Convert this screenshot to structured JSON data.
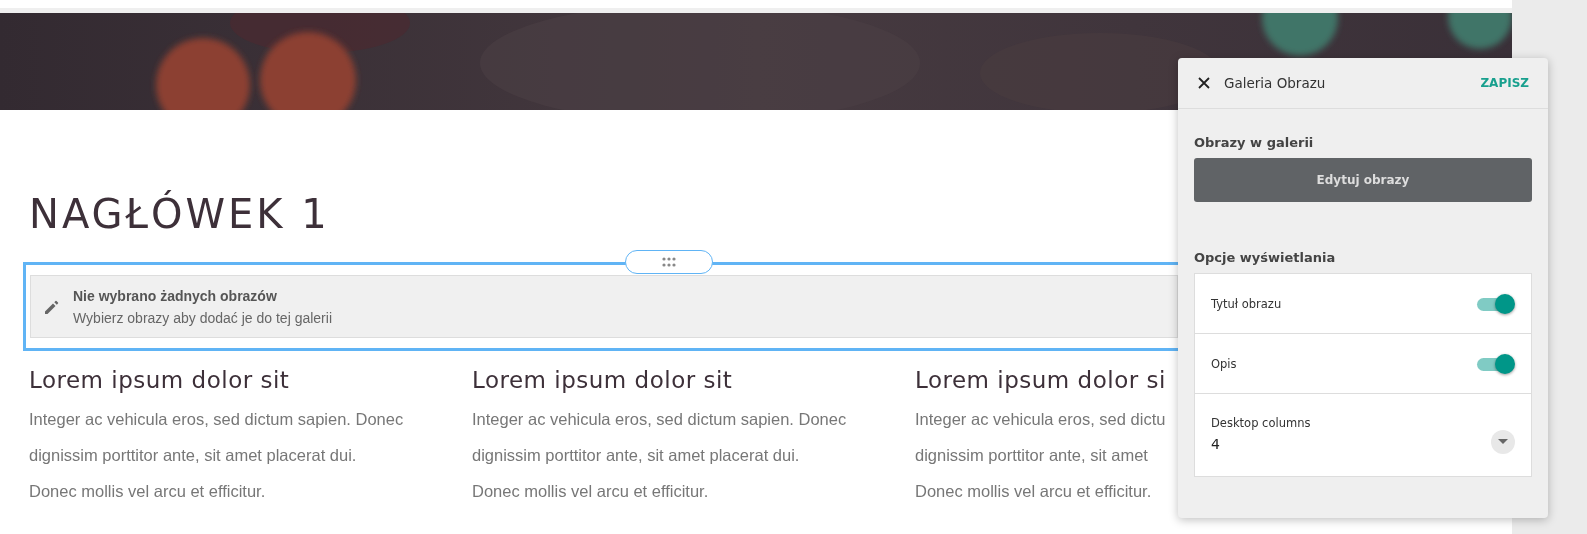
{
  "heading": "NAGŁÓWEK 1",
  "gallery_block": {
    "selected": true,
    "title": "Nie wybrano żadnych obrazów",
    "hint": "Wybierz obrazy aby dodać je do tej galerii"
  },
  "columns": [
    {
      "title": "Lorem ipsum dolor sit",
      "lines": [
        "Integer ac vehicula eros, sed dictum sapien. Donec",
        "dignissim porttitor ante, sit amet placerat dui.",
        "Donec mollis vel arcu et efficitur."
      ]
    },
    {
      "title": "Lorem ipsum dolor sit",
      "lines": [
        "Integer ac vehicula eros, sed dictum sapien. Donec",
        "dignissim porttitor ante, sit amet placerat dui.",
        "Donec mollis vel arcu et efficitur."
      ]
    },
    {
      "title": "Lorem ipsum dolor si",
      "lines": [
        "Integer ac vehicula eros, sed dictu",
        "dignissim porttitor ante, sit amet",
        "Donec mollis vel arcu et efficitur."
      ]
    }
  ],
  "panel": {
    "title": "Galeria Obrazu",
    "save": "ZAPISZ",
    "images_section": {
      "label": "Obrazy w galerii",
      "button": "Edytuj obrazy"
    },
    "display_section": {
      "label": "Opcje wyświetlania",
      "options": [
        {
          "kind": "toggle",
          "label": "Tytuł obrazu",
          "on": true
        },
        {
          "kind": "toggle",
          "label": "Opis",
          "on": true
        },
        {
          "kind": "select",
          "label": "Desktop columns",
          "value": "4"
        }
      ]
    }
  }
}
